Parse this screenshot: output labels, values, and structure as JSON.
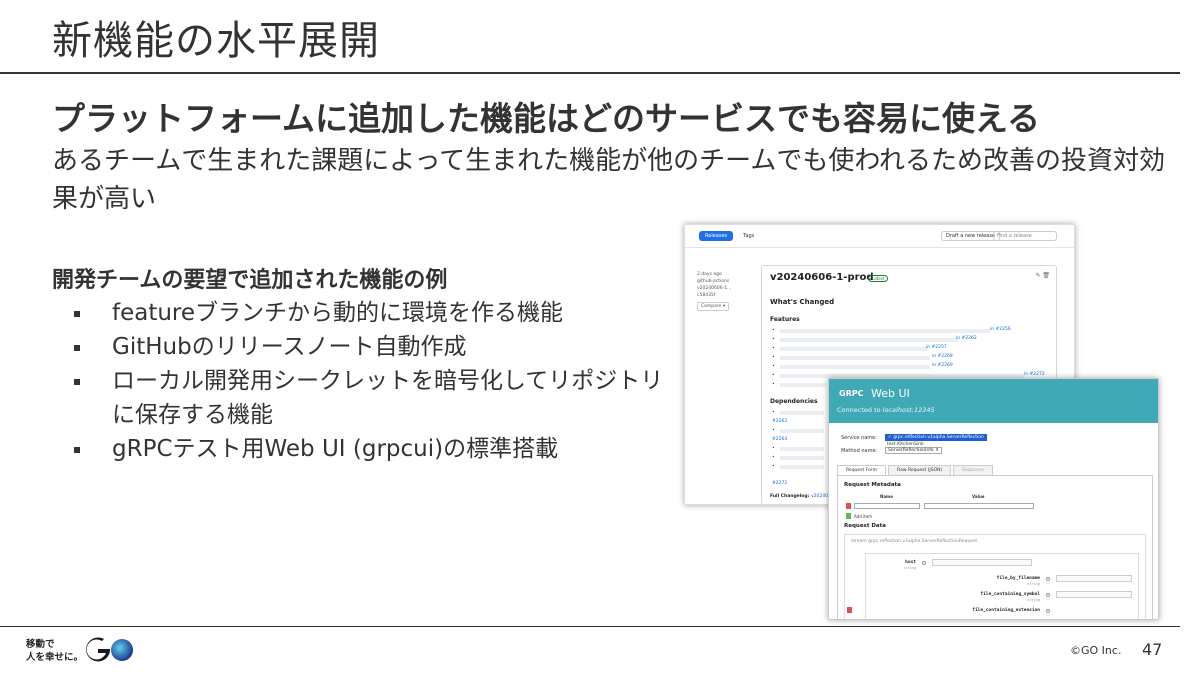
{
  "slide": {
    "title": "新機能の水平展開",
    "headline": "プラットフォームに追加した機能はどのサービスでも容易に使える",
    "subline": "あるチームで生まれた課題によって生まれた機能が他のチームでも使われるため改善の投資対効果が高い",
    "list_heading": "開発チームの要望で追加された機能の例",
    "bullets": [
      "featureブランチから動的に環境を作る機能",
      "GitHubのリリースノート自動作成",
      "ローカル開発用シークレットを暗号化してリポジトリに保存する機能",
      "gRPCテスト用Web UI (grpcui)の標準搭載"
    ]
  },
  "releases_screenshot": {
    "tab_releases": "Releases",
    "tab_tags": "Tags",
    "draft_button": "Draft a new release",
    "find_placeholder": "Find a release",
    "age": "2 days ago",
    "author": "github-actions",
    "tag": "v20240606-1...",
    "commit": "c58435f",
    "compare": "Compare",
    "release_name": "v20240606-1-prod",
    "latest_badge": "Latest",
    "whats_changed": "What's Changed",
    "features_heading": "Features",
    "features": [
      {
        "text": "in #2256"
      },
      {
        "text": "in #2262"
      },
      {
        "text": "in #2257"
      },
      {
        "text": "in #2268"
      },
      {
        "text": "in #2269"
      },
      {
        "text": "in #2272"
      }
    ],
    "dependencies_heading": "Dependencies",
    "dependencies": [
      "#2263",
      "#2264",
      "#2272"
    ],
    "full_changelog_label": "Full Changelog:",
    "full_changelog_link": "v2024060"
  },
  "grpcui_screenshot": {
    "logo": "GRPC",
    "title": "Web UI",
    "connected_prefix": "Connected to",
    "connected_host": "localhost:12345",
    "service_label": "Service name:",
    "service_selected": "✓ grpc.reflection.v1alpha.ServerReflection",
    "service_option": "test.KitchenSink",
    "method_label": "Method name:",
    "method_value": "ServerReflectionInfo",
    "tabs": [
      "Request Form",
      "Raw Request (JSON)",
      "Response"
    ],
    "request_metadata": "Request Metadata",
    "col_name": "Name",
    "col_value": "Value",
    "add_item": "Add item",
    "request_data": "Request Data",
    "request_type": "stream grpc.reflection.v1alpha.ServerReflectionRequest",
    "fields": [
      {
        "name": "host",
        "type": "string"
      },
      {
        "name": "file_by_filename",
        "type": "string"
      },
      {
        "name": "file_containing_symbol",
        "type": "string"
      },
      {
        "name": "file_containing_extension",
        "type": ""
      }
    ]
  },
  "footer": {
    "brand_line1": "移動で",
    "brand_line2": "人を幸せに。",
    "copyright": "©GO Inc.",
    "page_number": "47"
  },
  "colors": {
    "text": "#333333",
    "grpc_header": "#3fa9b5",
    "github_blue": "#1f6feb",
    "go_gradient": [
      "#1aa0e0",
      "#1d3a8a"
    ]
  }
}
